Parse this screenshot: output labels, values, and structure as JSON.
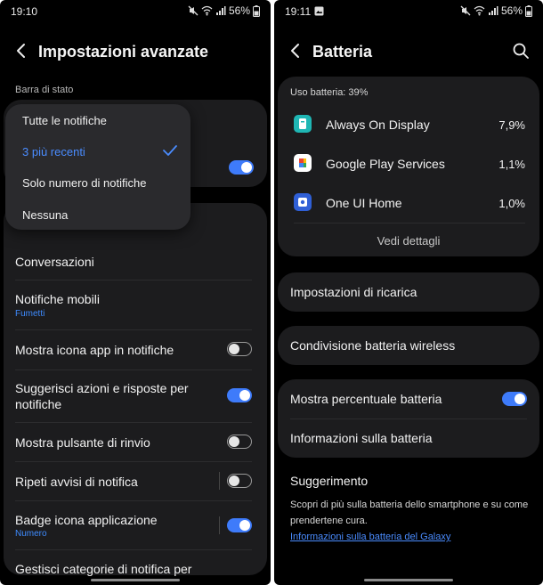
{
  "left": {
    "status": {
      "time": "19:10",
      "battery": "56%"
    },
    "header": {
      "title": "Impostazioni avanzate"
    },
    "section_label": "Barra di stato",
    "popup": {
      "items": [
        "Tutte le notifiche",
        "3 più recenti",
        "Solo numero di notifiche",
        "Nessuna"
      ],
      "selected": "3 più recenti"
    },
    "rows": {
      "conversazioni": "Conversazioni",
      "notifiche_mobili": "Notifiche mobili",
      "notifiche_mobili_sub": "Fumetti",
      "mostra_icona": "Mostra icona app in notifiche",
      "suggerisci_1": "Suggerisci azioni e risposte per",
      "suggerisci_2": "notifiche",
      "pulsante_rinvio": "Mostra pulsante di rinvio",
      "ripeti_avvisi": "Ripeti avvisi di notifica",
      "badge": "Badge icona applicazione",
      "badge_sub": "Numero",
      "gestisci": "Gestisci categorie di notifica per"
    },
    "toggles": {
      "hidden_row": true,
      "mostra_icona": false,
      "suggerisci": true,
      "pulsante_rinvio": false,
      "ripeti_avvisi": false,
      "badge": true
    }
  },
  "right": {
    "status": {
      "time": "19:11",
      "battery": "56%"
    },
    "header": {
      "title": "Batteria"
    },
    "usage_label": "Uso batteria: 39%",
    "apps": [
      {
        "name": "Always On Display",
        "percent": "7,9%",
        "icon": "aod-icon",
        "color": "#1fb6b4"
      },
      {
        "name": "Google Play Services",
        "percent": "1,1%",
        "icon": "google-play-services-icon",
        "color": "#ffffff"
      },
      {
        "name": "One UI Home",
        "percent": "1,0%",
        "icon": "one-ui-home-icon",
        "color": "#2f5fd6"
      }
    ],
    "details_button": "Vedi dettagli",
    "items": {
      "ricarica": "Impostazioni di ricarica",
      "condivisione": "Condivisione batteria wireless",
      "percentuale": "Mostra percentuale batteria",
      "informazioni": "Informazioni sulla batteria"
    },
    "percentuale_toggle": true,
    "tip": {
      "title": "Suggerimento",
      "text": "Scopri di più sulla batteria dello smartphone e su come prendertene cura.",
      "link": "Informazioni sulla batteria del Galaxy"
    }
  }
}
